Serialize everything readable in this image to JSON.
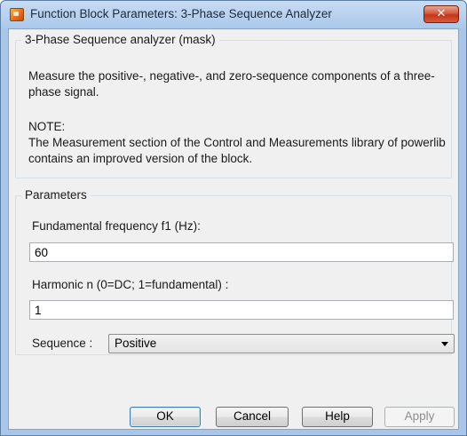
{
  "window": {
    "title": "Function Block Parameters: 3-Phase Sequence Analyzer",
    "close_glyph": "✕",
    "icon": "simulink-block-icon"
  },
  "mask": {
    "group_title": "3-Phase Sequence analyzer (mask)",
    "description": "Measure the positive-, negative-, and zero-sequence components of a three-phase signal.",
    "note_heading": "NOTE:",
    "note_text": "The Measurement section of the Control and Measurements library of powerlib contains an improved version of the block."
  },
  "parameters": {
    "group_title": "Parameters",
    "f1_label": "Fundamental frequency f1 (Hz):",
    "f1_value": "60",
    "harmonic_label": "Harmonic n (0=DC; 1=fundamental) :",
    "harmonic_value": "1",
    "sequence_label": "Sequence :",
    "sequence_value": "Positive"
  },
  "buttons": {
    "ok": "OK",
    "cancel": "Cancel",
    "help": "Help",
    "apply": "Apply"
  }
}
